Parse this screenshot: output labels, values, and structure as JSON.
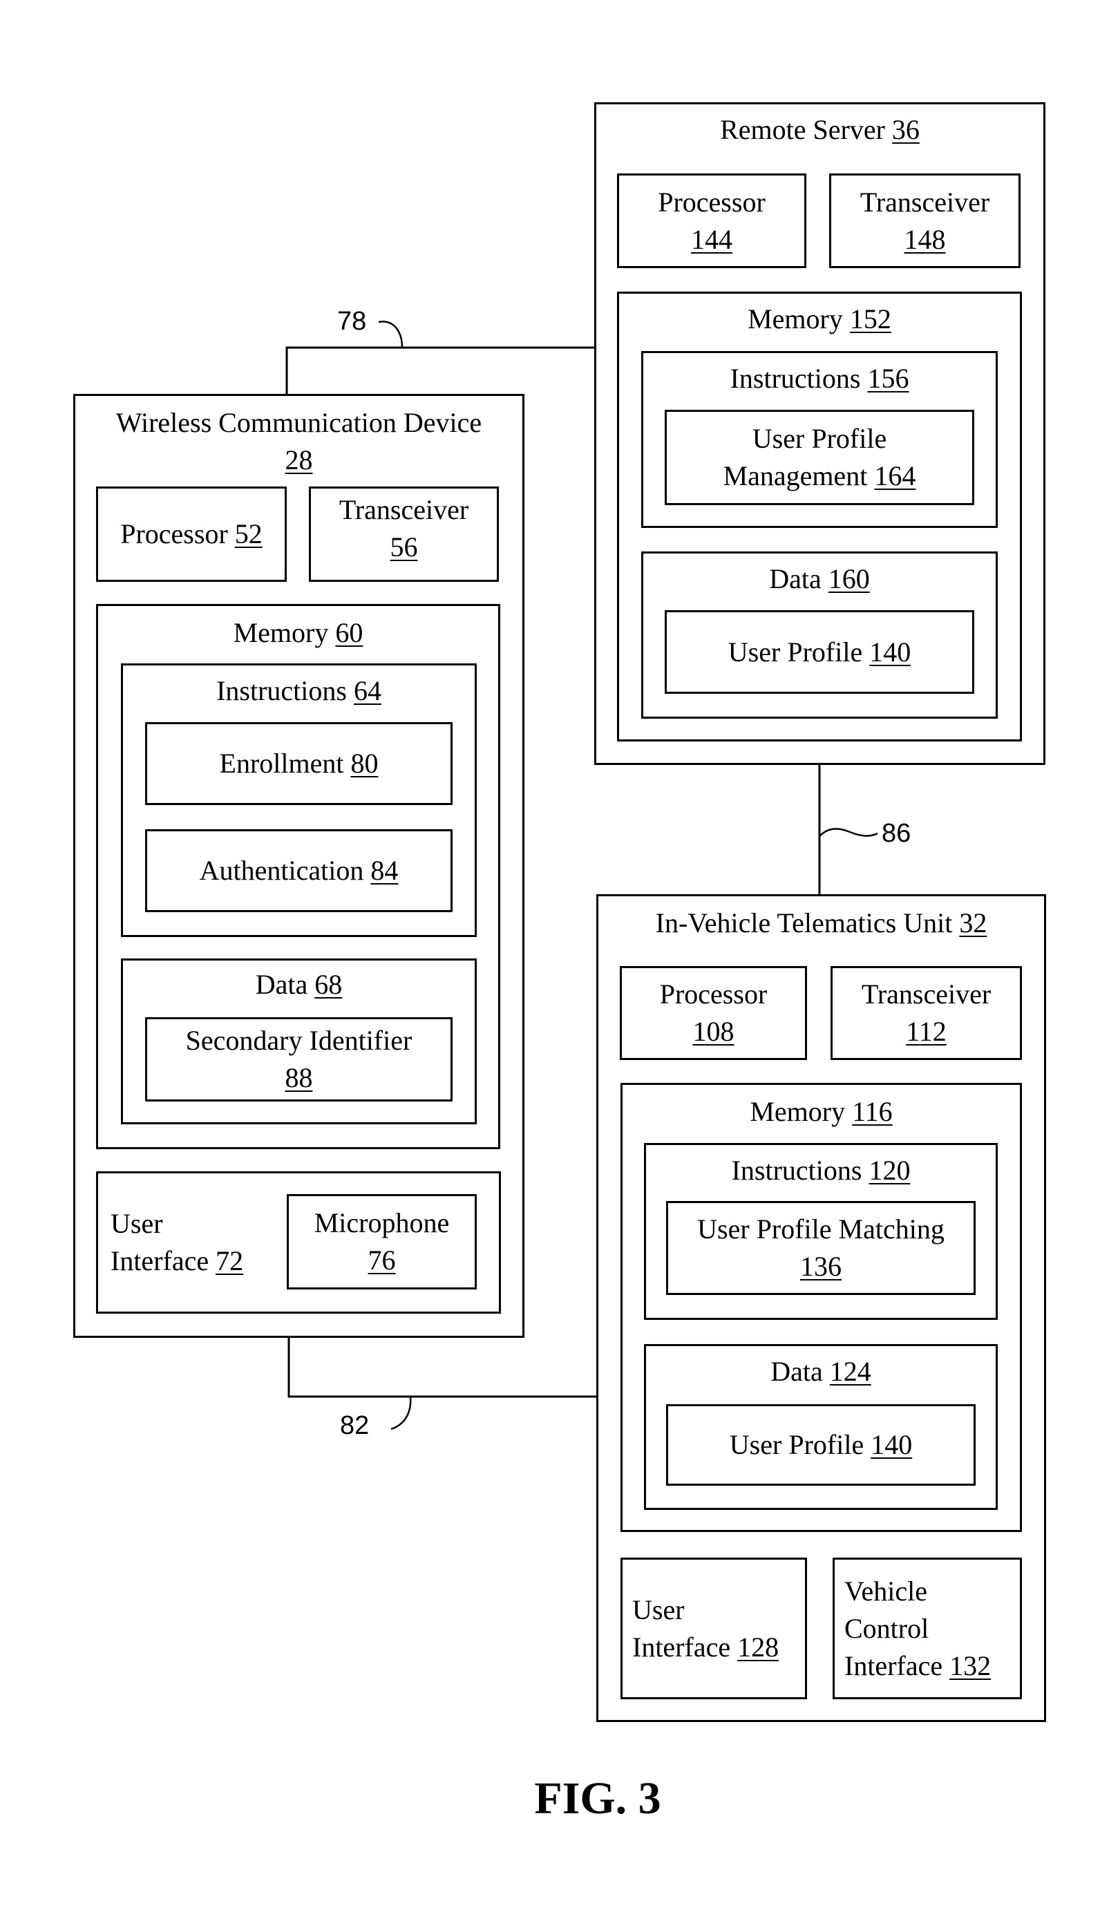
{
  "figure": {
    "caption": "FIG. 3"
  },
  "connections": [
    {
      "ref": "78",
      "from": "wireless_device",
      "to": "remote_server"
    },
    {
      "ref": "86",
      "from": "remote_server",
      "to": "telematics_unit"
    },
    {
      "ref": "82",
      "from": "wireless_device",
      "to": "telematics_unit"
    }
  ],
  "remote_server": {
    "title": "Remote Server",
    "num": "36",
    "processor": {
      "title": "Processor",
      "num": "144"
    },
    "transceiver": {
      "title": "Transceiver",
      "num": "148"
    },
    "memory": {
      "title": "Memory",
      "num": "152",
      "instructions": {
        "title": "Instructions",
        "num": "156",
        "module": {
          "line1": "User Profile",
          "line2": "Management",
          "num": "164"
        }
      },
      "data": {
        "title": "Data",
        "num": "160",
        "item": {
          "title": "User Profile",
          "num": "140"
        }
      }
    }
  },
  "wireless_device": {
    "title": "Wireless Communication Device",
    "num": "28",
    "processor": {
      "title": "Processor",
      "num": "52"
    },
    "transceiver": {
      "title": "Transceiver",
      "num": "56"
    },
    "memory": {
      "title": "Memory",
      "num": "60",
      "instructions": {
        "title": "Instructions",
        "num": "64",
        "enrollment": {
          "title": "Enrollment",
          "num": "80"
        },
        "authentication": {
          "title": "Authentication",
          "num": "84"
        }
      },
      "data": {
        "title": "Data",
        "num": "68",
        "item": {
          "title": "Secondary Identifier",
          "num": "88"
        }
      }
    },
    "user_interface": {
      "line1": "User",
      "line2": "Interface",
      "num": "72",
      "microphone": {
        "title": "Microphone",
        "num": "76"
      }
    }
  },
  "telematics_unit": {
    "title": "In-Vehicle Telematics Unit",
    "num": "32",
    "processor": {
      "title": "Processor",
      "num": "108"
    },
    "transceiver": {
      "title": "Transceiver",
      "num": "112"
    },
    "memory": {
      "title": "Memory",
      "num": "116",
      "instructions": {
        "title": "Instructions",
        "num": "120",
        "module": {
          "title": "User Profile Matching",
          "num": "136"
        }
      },
      "data": {
        "title": "Data",
        "num": "124",
        "item": {
          "title": "User Profile",
          "num": "140"
        }
      }
    },
    "user_interface": {
      "line1": "User",
      "line2": "Interface",
      "num": "128"
    },
    "vehicle_control": {
      "line1": "Vehicle",
      "line2": "Control",
      "line3": "Interface",
      "num": "132"
    }
  }
}
